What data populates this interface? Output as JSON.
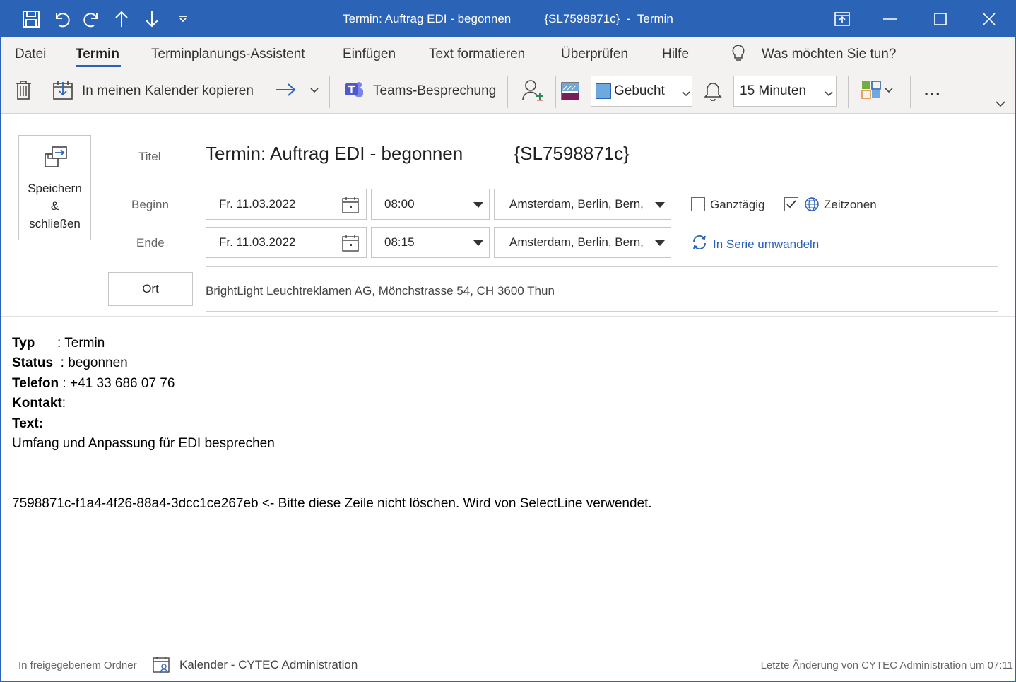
{
  "window": {
    "title_main": "Termin: Auftrag EDI - begonnen",
    "title_code": "{SL7598871c}",
    "title_kind": "Termin"
  },
  "tabs": [
    "Datei",
    "Termin",
    "Terminplanungs-Assistent",
    "Einfügen",
    "Text formatieren",
    "Überprüfen",
    "Hilfe"
  ],
  "search_placeholder": "Was möchten Sie tun?",
  "ribbon": {
    "copy_label": "In meinen Kalender kopieren",
    "teams_label": "Teams-Besprechung",
    "status_value": "Gebucht",
    "reminder_value": "15 Minuten",
    "more_label": "..."
  },
  "form": {
    "save_close_label": "Speichern & schließen",
    "save_line1": "Speichern",
    "save_line2": "&",
    "save_line3": "schließen",
    "title_label": "Titel",
    "title_value": "Termin: Auftrag EDI - begonnen          {SL7598871c}",
    "begin_label": "Beginn",
    "begin_date": "Fr. 11.03.2022",
    "begin_time": "08:00",
    "begin_tz": "Amsterdam, Berlin, Bern,",
    "allday_label": "Ganztägig",
    "allday_checked": false,
    "timezones_label": "Zeitzonen",
    "timezones_checked": true,
    "end_label": "Ende",
    "end_date": "Fr. 11.03.2022",
    "end_time": "08:15",
    "end_tz": "Amsterdam, Berlin, Bern,",
    "recurrence_label": "In Serie umwandeln",
    "location_button": "Ort",
    "location_value": "BrightLight Leuchtreklamen AG, Mönchstrasse 54, CH 3600 Thun"
  },
  "body": {
    "typ_label": "Typ",
    "typ_value": "      : Termin",
    "status_label": "Status",
    "status_value": "  : begonnen",
    "telefon_label": "Telefon",
    "telefon_value": " : +41 33 686 07 76",
    "kontakt_label": "Kontakt",
    "kontakt_value": ":",
    "text_label": "Text:",
    "text_value": "Umfang und Anpassung für EDI besprechen",
    "guid_line": "7598871c-f1a4-4f26-88a4-3dcc1ce267eb <- Bitte diese Zeile nicht löschen. Wird von SelectLine verwendet."
  },
  "footer": {
    "shared_folder": "In freigegebenem Ordner",
    "calendar": "Kalender - CYTEC Administration",
    "last_change": "Letzte Änderung von CYTEC Administration um 07:11"
  },
  "colors": {
    "accent": "#2b63b7",
    "link": "#2b63b7",
    "ribbon_bg": "#f3f2f1",
    "status_busy": "#6fa8dc"
  }
}
